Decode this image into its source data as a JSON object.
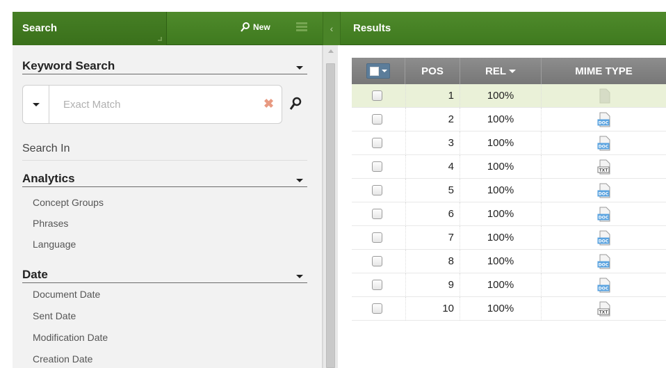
{
  "search_panel": {
    "title": "Search",
    "new_label": "New",
    "keyword_section": "Keyword Search",
    "keyword_placeholder": "Exact Match",
    "search_in_label": "Search In",
    "analytics": {
      "label": "Analytics",
      "items": [
        "Concept Groups",
        "Phrases",
        "Language"
      ]
    },
    "date": {
      "label": "Date",
      "items": [
        "Document Date",
        "Sent Date",
        "Modification Date",
        "Creation Date"
      ]
    }
  },
  "results_panel": {
    "title": "Results",
    "columns": {
      "pos": "POS",
      "rel": "REL",
      "mime": "MIME TYPE"
    },
    "rows": [
      {
        "pos": "1",
        "rel": "100%",
        "mime": "generic",
        "selected": true
      },
      {
        "pos": "2",
        "rel": "100%",
        "mime": "doc",
        "selected": false
      },
      {
        "pos": "3",
        "rel": "100%",
        "mime": "doc",
        "selected": false
      },
      {
        "pos": "4",
        "rel": "100%",
        "mime": "txt",
        "selected": false
      },
      {
        "pos": "5",
        "rel": "100%",
        "mime": "doc",
        "selected": false
      },
      {
        "pos": "6",
        "rel": "100%",
        "mime": "doc",
        "selected": false
      },
      {
        "pos": "7",
        "rel": "100%",
        "mime": "doc",
        "selected": false
      },
      {
        "pos": "8",
        "rel": "100%",
        "mime": "doc",
        "selected": false
      },
      {
        "pos": "9",
        "rel": "100%",
        "mime": "doc",
        "selected": false
      },
      {
        "pos": "10",
        "rel": "100%",
        "mime": "txt",
        "selected": false
      }
    ]
  },
  "mime_badges": {
    "doc": "DOC",
    "txt": "TXT"
  },
  "colors": {
    "header_green": "#3f7a1f",
    "selected_row": "#eaf1d8",
    "table_header": "#808080",
    "doc_icon": "#5aa3e0"
  }
}
